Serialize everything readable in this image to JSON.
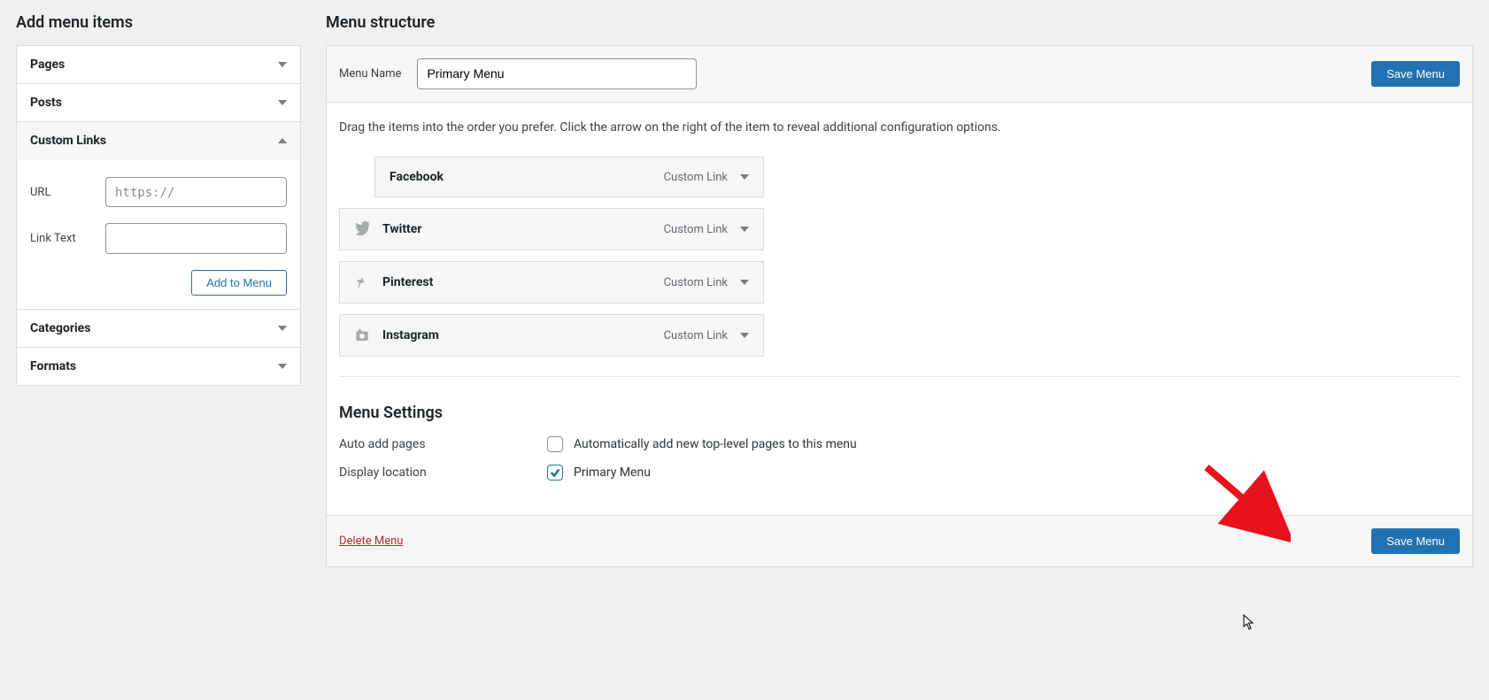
{
  "left": {
    "title": "Add menu items",
    "panels": {
      "pages": "Pages",
      "posts": "Posts",
      "custom_links": "Custom Links",
      "categories": "Categories",
      "formats": "Formats"
    },
    "custom_links": {
      "url_label": "URL",
      "url_placeholder": "https://",
      "text_label": "Link Text",
      "add_button": "Add to Menu"
    }
  },
  "right": {
    "title": "Menu structure",
    "menu_name_label": "Menu Name",
    "menu_name_value": "Primary Menu",
    "save_button": "Save Menu",
    "instructions": "Drag the items into the order you prefer. Click the arrow on the right of the item to reveal additional configuration options.",
    "items": [
      {
        "title": "Facebook",
        "type": "Custom Link",
        "indent": true,
        "icon": "none"
      },
      {
        "title": "Twitter",
        "type": "Custom Link",
        "indent": false,
        "icon": "twitter"
      },
      {
        "title": "Pinterest",
        "type": "Custom Link",
        "indent": false,
        "icon": "pin"
      },
      {
        "title": "Instagram",
        "type": "Custom Link",
        "indent": false,
        "icon": "camera"
      }
    ],
    "settings": {
      "heading": "Menu Settings",
      "auto_add_label": "Auto add pages",
      "auto_add_option": "Automatically add new top-level pages to this menu",
      "auto_add_checked": false,
      "display_loc_label": "Display location",
      "display_loc_option": "Primary Menu",
      "display_loc_checked": true
    },
    "delete_label": "Delete Menu"
  }
}
